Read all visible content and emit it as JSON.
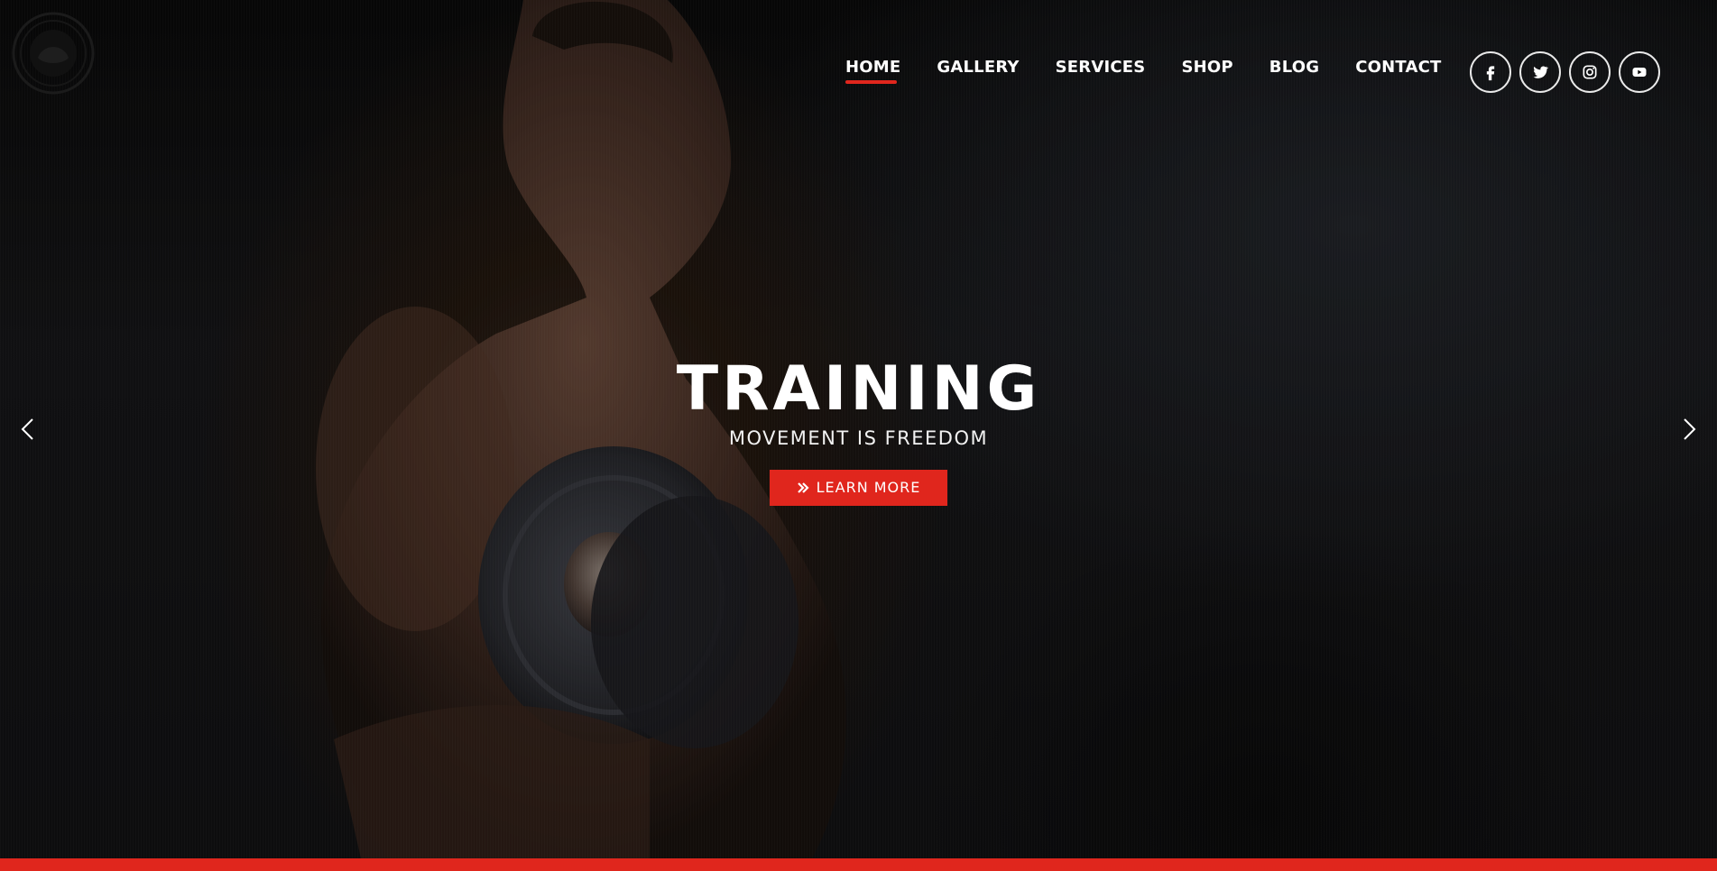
{
  "nav": {
    "items": [
      {
        "label": "HOME",
        "active": true
      },
      {
        "label": "GALLERY",
        "active": false
      },
      {
        "label": "SERVICES",
        "active": false
      },
      {
        "label": "SHOP",
        "active": false
      },
      {
        "label": "BLOG",
        "active": false
      },
      {
        "label": "CONTACT",
        "active": false
      }
    ]
  },
  "social": [
    "facebook-icon",
    "twitter-icon",
    "instagram-icon",
    "youtube-icon"
  ],
  "hero": {
    "title": "TRAINING",
    "subtitle": "MOVEMENT IS FREEDOM",
    "cta_label": "LEARN MORE",
    "cta_icon": "double-chevron-right-icon"
  },
  "slider": {
    "prev_icon": "chevron-left-icon",
    "next_icon": "chevron-right-icon"
  },
  "colors": {
    "accent": "#e0261d",
    "text": "#ffffff",
    "background": "#121214"
  }
}
